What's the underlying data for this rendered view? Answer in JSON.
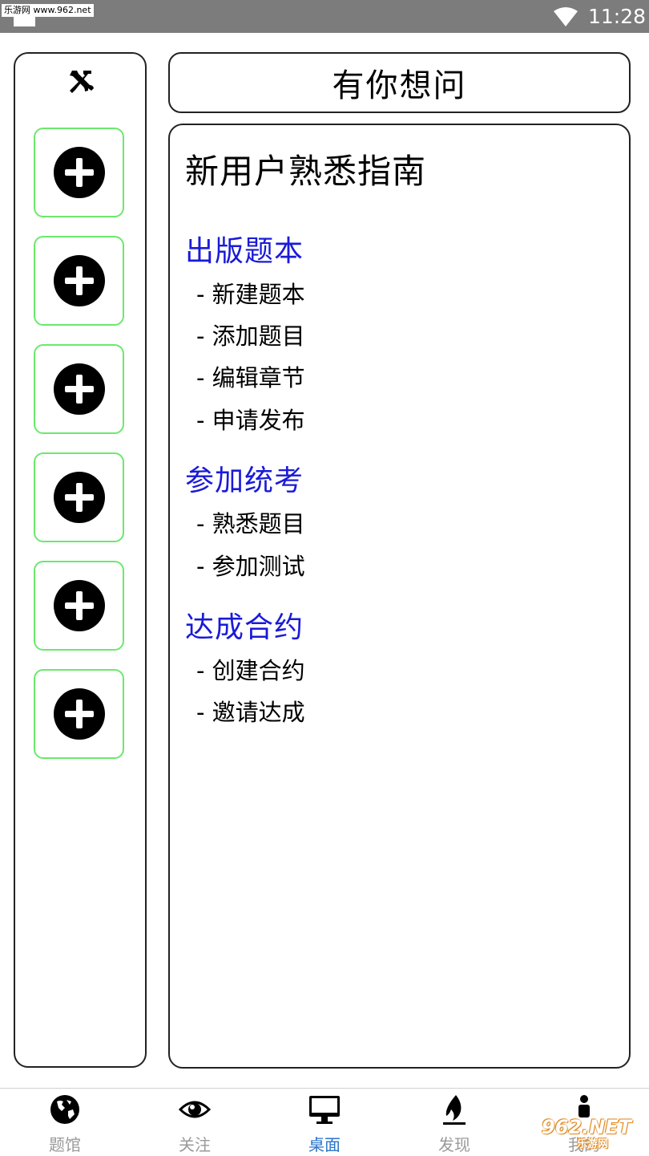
{
  "status_bar": {
    "watermark": "乐游网 www.962.net",
    "time": "11:28"
  },
  "left_panel": {
    "slot_count": 6
  },
  "title_box": {
    "title": "有你想问"
  },
  "guide": {
    "title": "新用户熟悉指南",
    "sections": [
      {
        "title": "出版题本",
        "items": [
          "- 新建题本",
          "- 添加题目",
          "- 编辑章节",
          "- 申请发布"
        ]
      },
      {
        "title": "参加统考",
        "items": [
          "- 熟悉题目",
          "- 参加测试"
        ]
      },
      {
        "title": "达成合约",
        "items": [
          "- 创建合约",
          "- 邀请达成"
        ]
      }
    ]
  },
  "bottom_nav": {
    "tabs": [
      {
        "label": "题馆",
        "icon": "globe-icon"
      },
      {
        "label": "关注",
        "icon": "eye-icon"
      },
      {
        "label": "桌面",
        "icon": "monitor-icon",
        "active": true
      },
      {
        "label": "发现",
        "icon": "flame-icon"
      },
      {
        "label": "我的",
        "icon": "person-icon"
      }
    ],
    "active_color": "#2a73c9",
    "inactive_color": "#9a9a9a"
  },
  "watermark_962": {
    "logo": "962.NET",
    "text": "乐游网"
  },
  "colors": {
    "section_title": "#1a1ad8",
    "slot_border": "#6ce86c",
    "status_bar": "#7c7c7c"
  }
}
